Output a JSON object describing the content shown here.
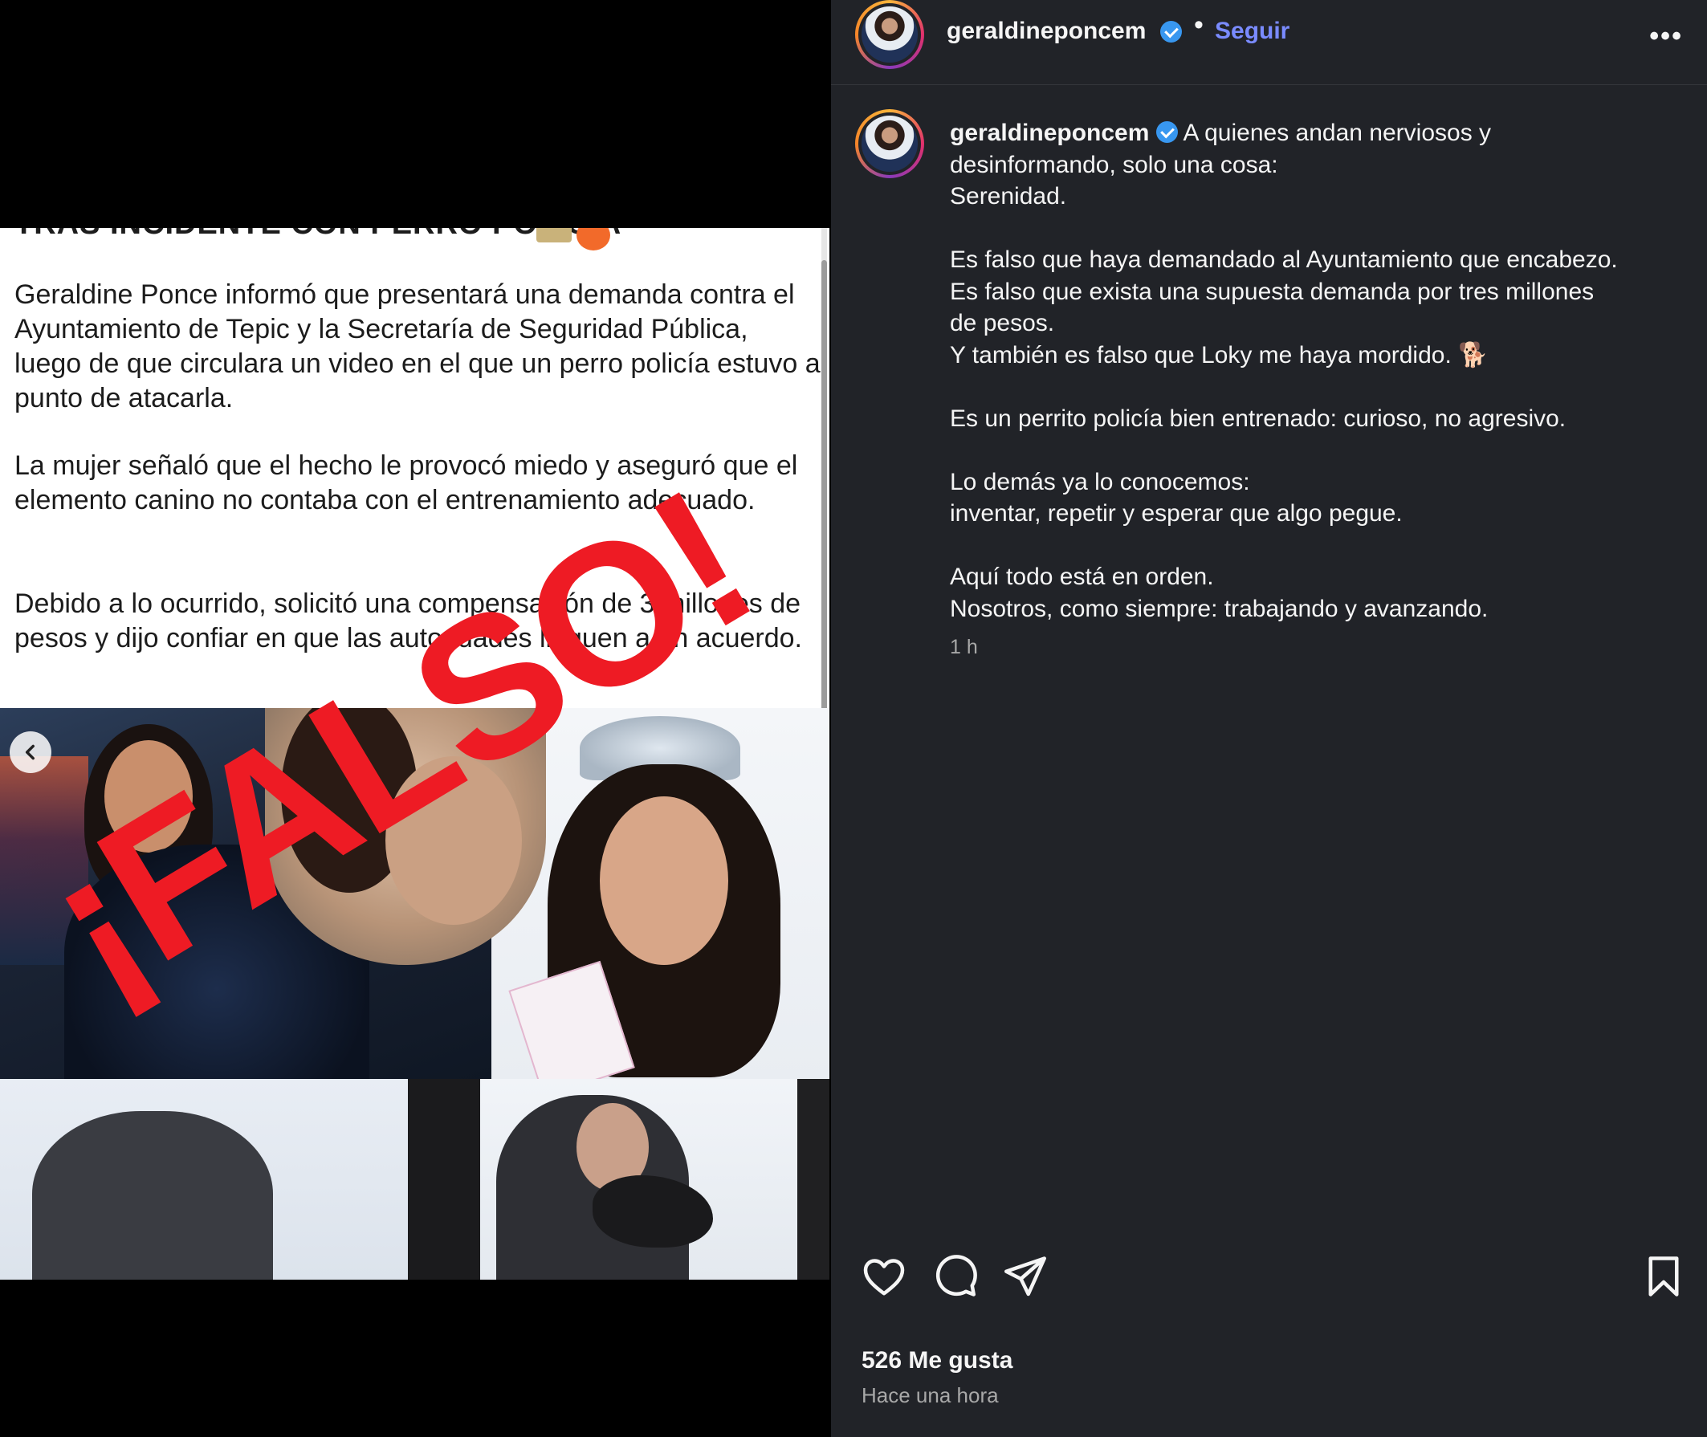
{
  "post_image": {
    "headline_fragment": "TRAS INCIDENTE CON PERRO POLICIA",
    "paragraphs": [
      "Geraldine Ponce informó que presentará una demanda contra el Ayuntamiento de Tepic y la Secretaría de Seguridad Pública, luego de que circulara un video en el que un perro policía estuvo a punto de atacarla.",
      "La mujer señaló que el hecho le provocó miedo y aseguró que el elemento canino no contaba con el entrenamiento adecuado.",
      "Debido a lo ocurrido, solicitó una compensación de 3 millones de pesos y dijo confiar en que las autoridades lleguen a un acuerdo."
    ],
    "stamp_text": "¡FALSO!",
    "stamp_color": "#ee1b24",
    "prev_icon": "chevron-left-icon"
  },
  "header": {
    "username": "geraldineponcem",
    "separator": "•",
    "follow_label": "Seguir",
    "more_icon": "more-horizontal-icon",
    "more_label": "•••",
    "follow_color": "#7a8bff"
  },
  "caption": {
    "username": "geraldineponcem",
    "line1": "A quienes andan nerviosos y",
    "line2": "desinformando, solo una cosa:",
    "line3": "Serenidad.",
    "line4": "Es falso que haya demandado al Ayuntamiento que encabezo.",
    "line5": "Es falso que exista una supuesta demanda por tres millones",
    "line6": "de pesos.",
    "line7": "Y también es falso que Loky me haya mordido. 🐕",
    "line8": "Es un perrito policía bien entrenado: curioso, no agresivo.",
    "line9": "Lo demás ya lo conocemos:",
    "line10": "inventar, repetir y esperar que algo pegue.",
    "line11": "Aquí todo está en orden.",
    "line12": "Nosotros, como siempre: trabajando y avanzando.",
    "time": "1 h"
  },
  "actions": {
    "like_icon": "heart-icon",
    "comment_icon": "comment-icon",
    "share_icon": "send-icon",
    "save_icon": "bookmark-icon"
  },
  "stats": {
    "likes": "526 Me gusta",
    "posted": "Hace una hora"
  },
  "colors": {
    "panel_bg": "#212328",
    "verified": "#3897f0"
  }
}
